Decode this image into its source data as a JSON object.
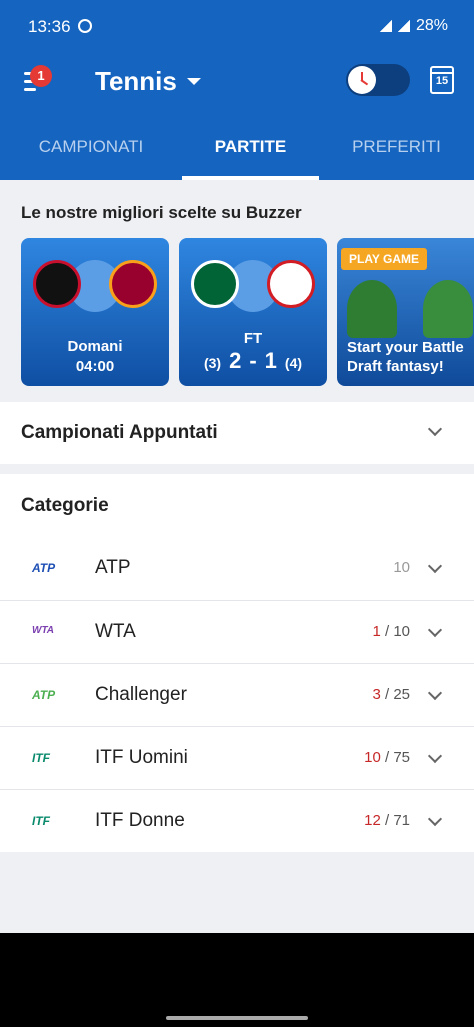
{
  "status_bar": {
    "time": "13:36",
    "battery": "28%"
  },
  "app_bar": {
    "notification_count": "1",
    "sport": "Tennis",
    "calendar_day": "15"
  },
  "tabs": [
    {
      "label": "CAMPIONATI"
    },
    {
      "label": "PARTITE"
    },
    {
      "label": "PREFERITI"
    }
  ],
  "picks": {
    "title": "Le nostre migliori scelte su Buzzer",
    "cards": [
      {
        "line1": "Domani",
        "line2": "04:00"
      },
      {
        "status": "FT",
        "home_pen": "(3)",
        "home_score": "2",
        "sep": "-",
        "away_score": "1",
        "away_pen": "(4)"
      },
      {
        "badge": "PLAY GAME",
        "caption": "Start your Battle Draft fantasy!"
      }
    ]
  },
  "pinned": {
    "label": "Campionati Appuntati"
  },
  "categories": {
    "title": "Categorie",
    "items": [
      {
        "name": "ATP",
        "live": "",
        "sep": "",
        "total": "10",
        "icon_text": "ATP"
      },
      {
        "name": "WTA",
        "live": "1",
        "sep": " / ",
        "total": "10",
        "icon_text": "WTA"
      },
      {
        "name": "Challenger",
        "live": "3",
        "sep": " / ",
        "total": "25",
        "icon_text": "ATP"
      },
      {
        "name": "ITF Uomini",
        "live": "10",
        "sep": " / ",
        "total": "75",
        "icon_text": "ITF"
      },
      {
        "name": "ITF Donne",
        "live": "12",
        "sep": " / ",
        "total": "71",
        "icon_text": "ITF"
      }
    ]
  },
  "colors": {
    "primary": "#1565c0",
    "live": "#c62828",
    "accent": "#f5a623"
  }
}
